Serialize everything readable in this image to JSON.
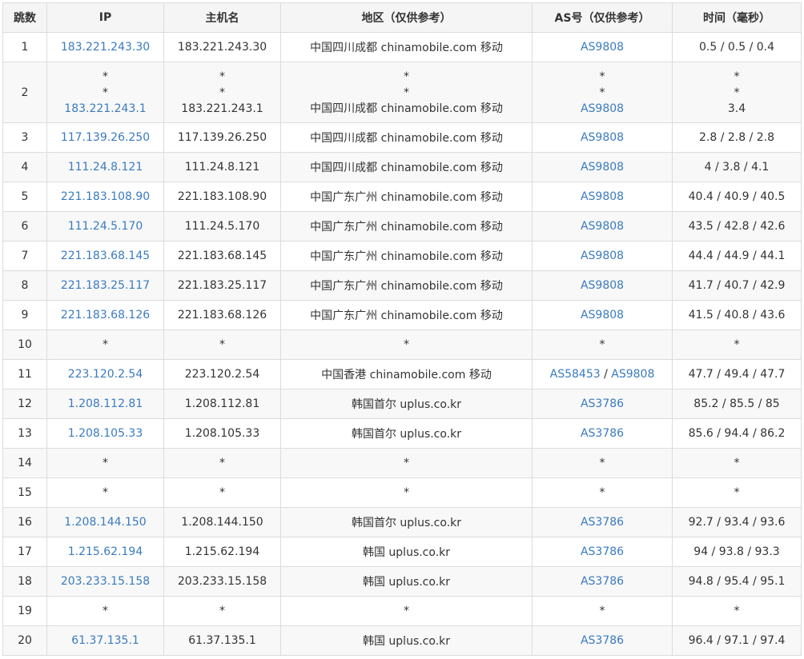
{
  "headers": {
    "hop": "跳数",
    "ip": "IP",
    "hostname": "主机名",
    "region": "地区（仅供参考）",
    "as": "AS号（仅供参考）",
    "time": "时间（毫秒）"
  },
  "colors": {
    "link": "#3a7bbf",
    "header_bg": "#f5f5f5",
    "border": "#dcdcdc",
    "alt_row_bg": "#f8f8f8"
  },
  "rows": [
    {
      "hop": "1",
      "ip": "183.221.243.30",
      "host": "183.221.243.30",
      "region": "中国四川成都 chinamobile.com 移动",
      "as1": "AS9808",
      "as2": "",
      "time": "0.5 / 0.5 / 0.4"
    },
    {
      "hop": "2",
      "ip_lines": [
        "*",
        "*",
        "183.221.243.1"
      ],
      "host_lines": [
        "*",
        "*",
        "183.221.243.1"
      ],
      "region_lines": [
        "*",
        "*",
        "中国四川成都 chinamobile.com 移动"
      ],
      "as_lines": [
        "*",
        "*",
        "AS9808"
      ],
      "time_lines": [
        "*",
        "*",
        "3.4"
      ]
    },
    {
      "hop": "3",
      "ip": "117.139.26.250",
      "host": "117.139.26.250",
      "region": "中国四川成都 chinamobile.com 移动",
      "as1": "AS9808",
      "as2": "",
      "time": "2.8 / 2.8 / 2.8"
    },
    {
      "hop": "4",
      "ip": "111.24.8.121",
      "host": "111.24.8.121",
      "region": "中国四川成都 chinamobile.com 移动",
      "as1": "AS9808",
      "as2": "",
      "time": "4 / 3.8 / 4.1"
    },
    {
      "hop": "5",
      "ip": "221.183.108.90",
      "host": "221.183.108.90",
      "region": "中国广东广州 chinamobile.com 移动",
      "as1": "AS9808",
      "as2": "",
      "time": "40.4 / 40.9 / 40.5"
    },
    {
      "hop": "6",
      "ip": "111.24.5.170",
      "host": "111.24.5.170",
      "region": "中国广东广州 chinamobile.com 移动",
      "as1": "AS9808",
      "as2": "",
      "time": "43.5 / 42.8 / 42.6"
    },
    {
      "hop": "7",
      "ip": "221.183.68.145",
      "host": "221.183.68.145",
      "region": "中国广东广州 chinamobile.com 移动",
      "as1": "AS9808",
      "as2": "",
      "time": "44.4 / 44.9 / 44.1"
    },
    {
      "hop": "8",
      "ip": "221.183.25.117",
      "host": "221.183.25.117",
      "region": "中国广东广州 chinamobile.com 移动",
      "as1": "AS9808",
      "as2": "",
      "time": "41.7 / 40.7 / 42.9"
    },
    {
      "hop": "9",
      "ip": "221.183.68.126",
      "host": "221.183.68.126",
      "region": "中国广东广州 chinamobile.com 移动",
      "as1": "AS9808",
      "as2": "",
      "time": "41.5 / 40.8 / 43.6"
    },
    {
      "hop": "10",
      "ip": "*",
      "host": "*",
      "region": "*",
      "as1": "*",
      "as2": "",
      "time": "*"
    },
    {
      "hop": "11",
      "ip": "223.120.2.54",
      "host": "223.120.2.54",
      "region": "中国香港 chinamobile.com 移动",
      "as1": "AS58453",
      "as2": "AS9808",
      "time": "47.7 / 49.4 / 47.7"
    },
    {
      "hop": "12",
      "ip": "1.208.112.81",
      "host": "1.208.112.81",
      "region": "韩国首尔 uplus.co.kr",
      "as1": "AS3786",
      "as2": "",
      "time": "85.2 / 85.5 / 85"
    },
    {
      "hop": "13",
      "ip": "1.208.105.33",
      "host": "1.208.105.33",
      "region": "韩国首尔 uplus.co.kr",
      "as1": "AS3786",
      "as2": "",
      "time": "85.6 / 94.4 / 86.2"
    },
    {
      "hop": "14",
      "ip": "*",
      "host": "*",
      "region": "*",
      "as1": "*",
      "as2": "",
      "time": "*"
    },
    {
      "hop": "15",
      "ip": "*",
      "host": "*",
      "region": "*",
      "as1": "*",
      "as2": "",
      "time": "*"
    },
    {
      "hop": "16",
      "ip": "1.208.144.150",
      "host": "1.208.144.150",
      "region": "韩国首尔 uplus.co.kr",
      "as1": "AS3786",
      "as2": "",
      "time": "92.7 / 93.4 / 93.6"
    },
    {
      "hop": "17",
      "ip": "1.215.62.194",
      "host": "1.215.62.194",
      "region": "韩国 uplus.co.kr",
      "as1": "AS3786",
      "as2": "",
      "time": "94 / 93.8 / 93.3"
    },
    {
      "hop": "18",
      "ip": "203.233.15.158",
      "host": "203.233.15.158",
      "region": "韩国 uplus.co.kr",
      "as1": "AS3786",
      "as2": "",
      "time": "94.8 / 95.4 / 95.1"
    },
    {
      "hop": "19",
      "ip": "*",
      "host": "*",
      "region": "*",
      "as1": "*",
      "as2": "",
      "time": "*"
    },
    {
      "hop": "20",
      "ip": "61.37.135.1",
      "host": "61.37.135.1",
      "region": "韩国 uplus.co.kr",
      "as1": "AS3786",
      "as2": "",
      "time": "96.4 / 97.1 / 97.4"
    }
  ]
}
